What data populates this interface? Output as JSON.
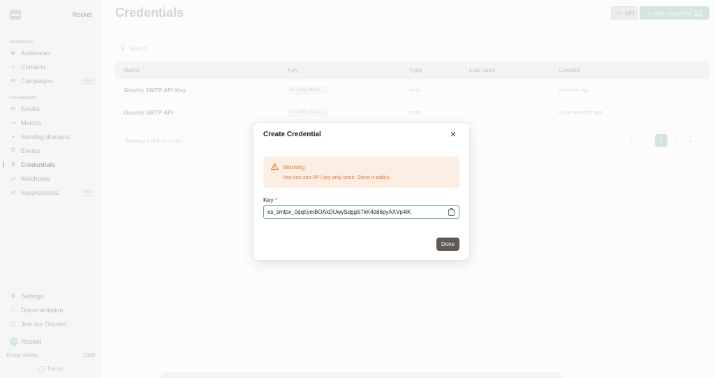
{
  "sidebar": {
    "workspace": "Rocket",
    "marketers_label": "Marketers",
    "developers_label": "Developers",
    "marketers": [
      {
        "label": "Audiences",
        "icon": "audiences-icon"
      },
      {
        "label": "Contacts",
        "icon": "contacts-icon"
      },
      {
        "label": "Campaigns",
        "icon": "campaigns-icon",
        "badge": "Beta"
      }
    ],
    "developers": [
      {
        "label": "Emails",
        "icon": "mail-icon"
      },
      {
        "label": "Metrics",
        "icon": "metrics-icon"
      },
      {
        "label": "Sending domains",
        "icon": "globe-icon"
      },
      {
        "label": "Events",
        "icon": "events-icon"
      },
      {
        "label": "Credentials",
        "icon": "key-icon",
        "active": true
      },
      {
        "label": "Webhooks",
        "icon": "webhook-icon"
      },
      {
        "label": "Suppressions",
        "icon": "block-icon",
        "badge": "Beta"
      }
    ],
    "footer": [
      {
        "label": "Settings",
        "icon": "gear-icon"
      },
      {
        "label": "Documentation",
        "icon": "book-icon"
      },
      {
        "label": "Join our Discord",
        "icon": "discord-icon"
      }
    ],
    "user": {
      "name": "Rocket",
      "initials": "RO"
    },
    "credits_label": "Email credits",
    "credits_value": "1000",
    "topup": "Top up"
  },
  "header": {
    "title": "Credentials",
    "api_label": "API",
    "add_label": "Add credential",
    "add_shortcut": "N"
  },
  "search": {
    "placeholder": "Search..."
  },
  "table": {
    "columns": [
      "Name",
      "Key",
      "Type",
      "Last used",
      "Created"
    ],
    "rows": [
      {
        "name": "Gravity SMTP API Key",
        "key": "es_smtp_O0z4...",
        "type": "smtp",
        "last_used": "",
        "created": "a minute ago"
      },
      {
        "name": "Gravity SMTP API",
        "key": "es_smtp_qSym...",
        "type": "smtp",
        "last_used": "",
        "created": "a few seconds ago"
      }
    ],
    "showing": "Showing 1 to 0 of results",
    "current_page": "1"
  },
  "modal": {
    "title": "Create Credential",
    "warning_title": "Warning",
    "warning_text": "You can see API key only once. Store it safely.",
    "key_label": "Key",
    "required_mark": "*",
    "key_value": "es_smtpx_0qq5ymBOAxDUwySdggS7kK4dd6pyAXVp4lK",
    "done_label": "Done"
  },
  "colors": {
    "accent": "#c4ddd3",
    "warning": "#e07a34",
    "warning_bg": "#fdeee4",
    "focus_border": "#5fa387",
    "done_button": "#615851"
  }
}
